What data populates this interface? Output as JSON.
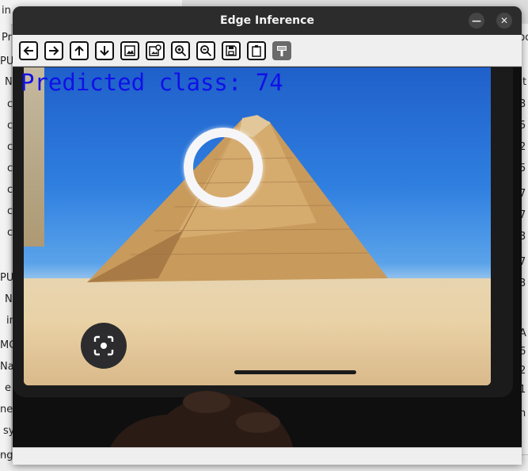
{
  "window": {
    "title": "Edge Inference",
    "minimize_glyph": "—",
    "close_glyph": "✕"
  },
  "toolbar": {
    "buttons": [
      {
        "name": "back",
        "icon": "arrow-left-icon"
      },
      {
        "name": "forward",
        "icon": "arrow-right-icon"
      },
      {
        "name": "up",
        "icon": "arrow-up-icon"
      },
      {
        "name": "down",
        "icon": "arrow-down-icon"
      },
      {
        "name": "image",
        "icon": "image-icon"
      },
      {
        "name": "image-settings",
        "icon": "image-gear-icon"
      },
      {
        "name": "zoom-in",
        "icon": "zoom-in-icon"
      },
      {
        "name": "zoom-out",
        "icon": "zoom-out-icon"
      },
      {
        "name": "save",
        "icon": "save-icon"
      },
      {
        "name": "clipboard",
        "icon": "clipboard-icon"
      },
      {
        "name": "properties",
        "icon": "brush-icon"
      }
    ]
  },
  "overlay": {
    "prediction_text": "Predicted class: 74",
    "color": "#1010e8"
  },
  "background_app": {
    "top_left_text": "in",
    "left_column": [
      "Pr",
      "PU",
      "N",
      "c",
      "c",
      "c",
      "c",
      "c",
      "c",
      "c",
      "PU",
      "N",
      "in",
      "MC",
      "Na",
      "e",
      "ne",
      "sy",
      "ng"
    ],
    "right_column": [
      "po",
      "at",
      "3",
      "5",
      "2",
      "5",
      "7",
      "7",
      "3",
      "7",
      "3",
      "A",
      "6",
      "2",
      "1",
      "n"
    ],
    "bottom_center": "Name",
    "bottom_right": "an"
  }
}
